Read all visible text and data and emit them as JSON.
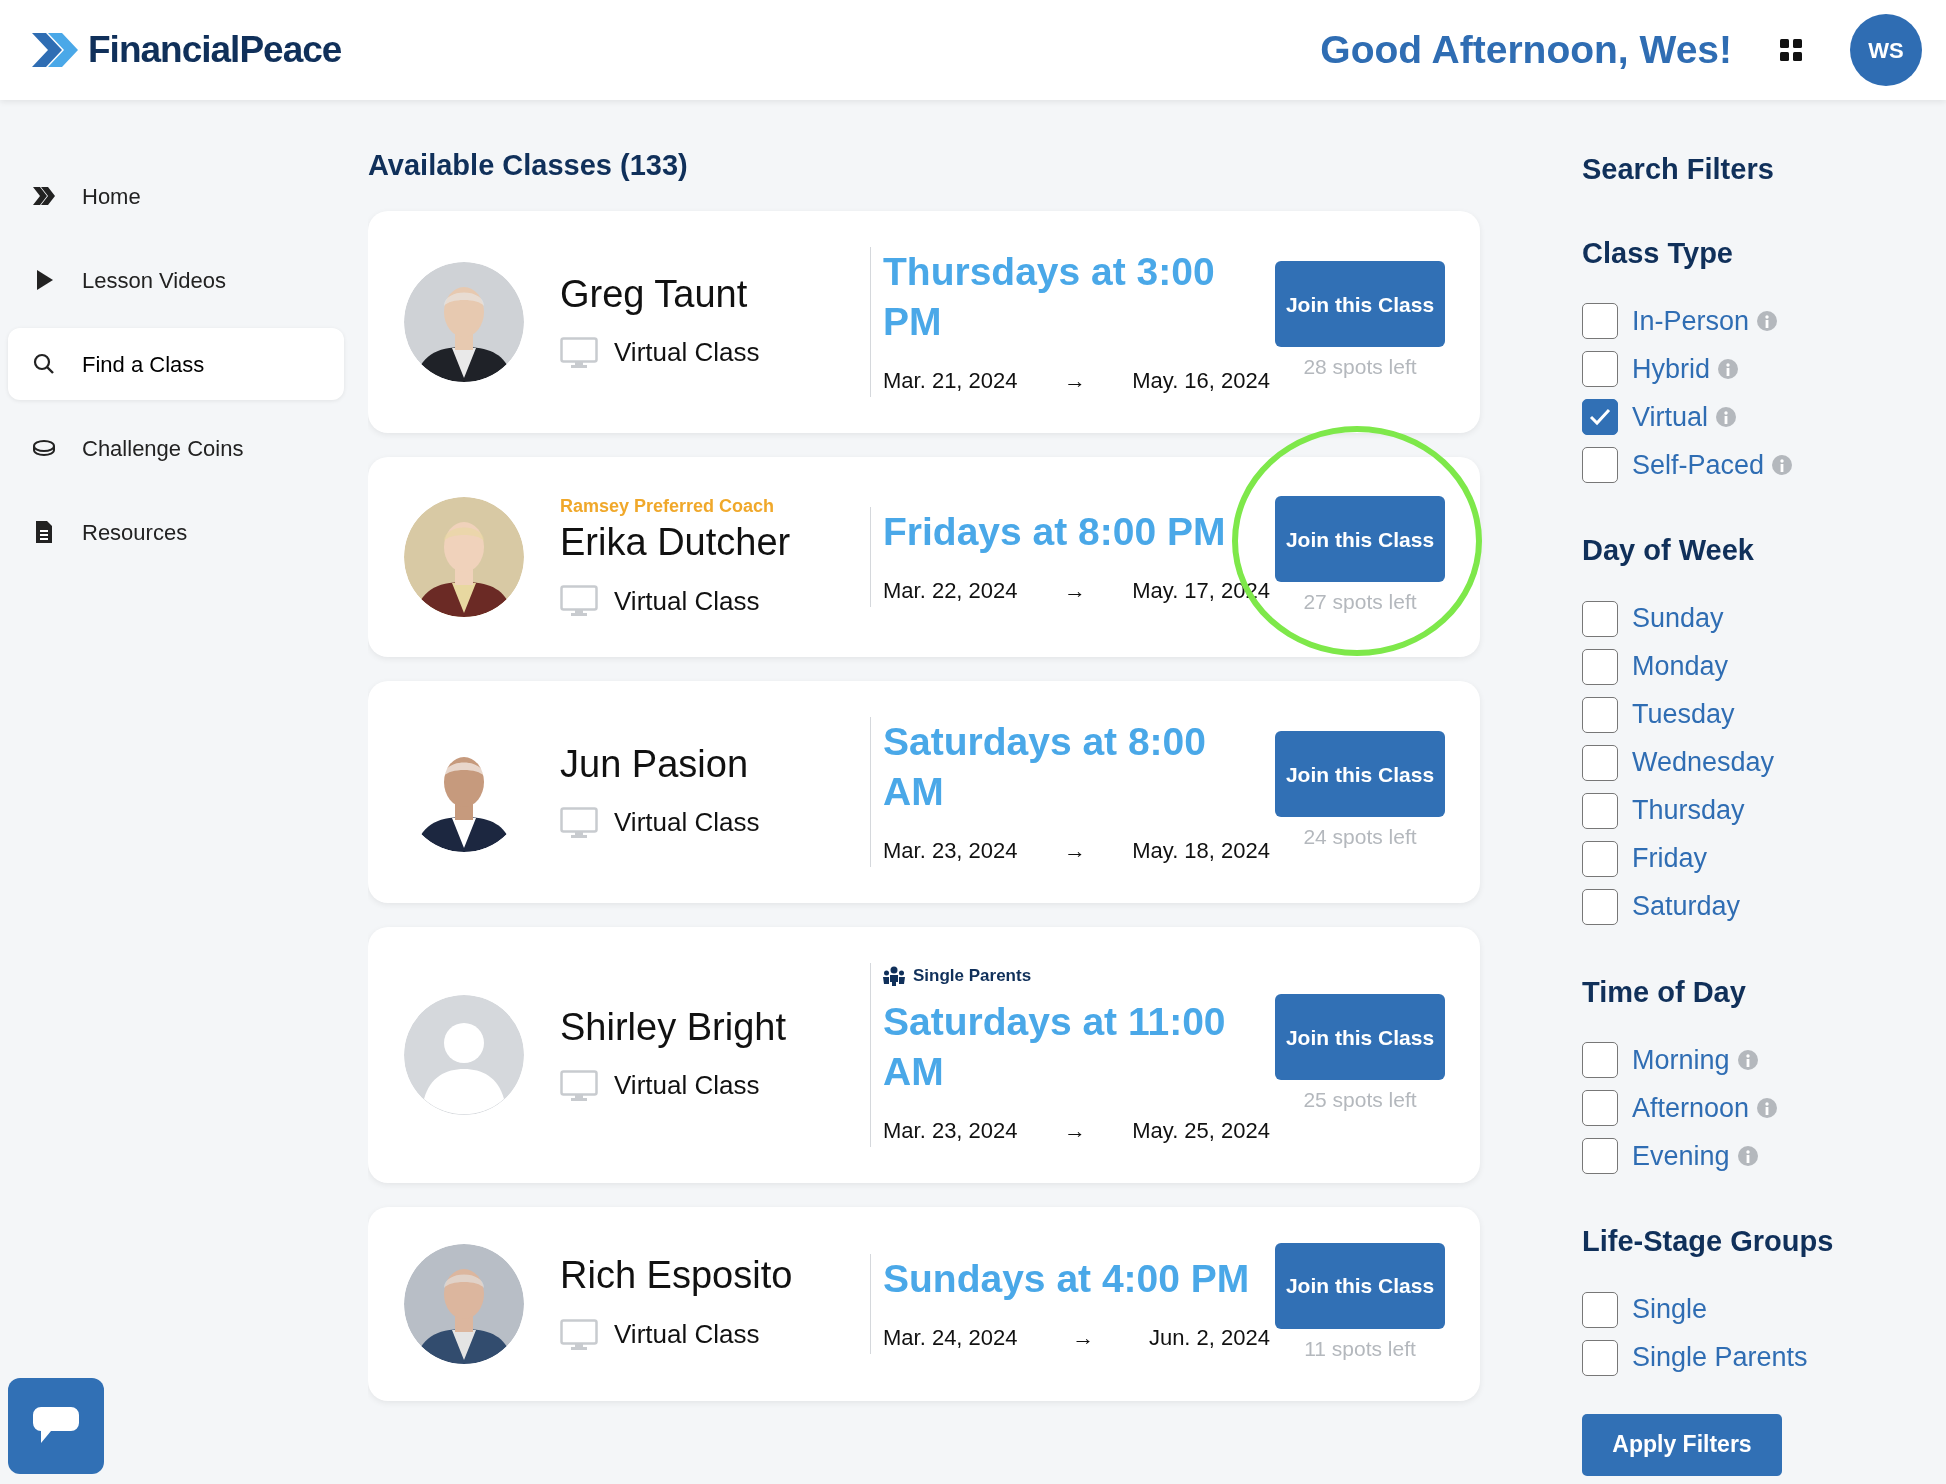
{
  "header": {
    "logo": "FinancialPeace",
    "greeting": "Good Afternoon, Wes!",
    "avatar_initials": "WS"
  },
  "sidebar": {
    "items": [
      {
        "label": "Home",
        "selected": false
      },
      {
        "label": "Lesson Videos",
        "selected": false
      },
      {
        "label": "Find a Class",
        "selected": true
      },
      {
        "label": "Challenge Coins",
        "selected": false
      },
      {
        "label": "Resources",
        "selected": false
      }
    ]
  },
  "main": {
    "title": "Available Classes (133)",
    "classes": [
      {
        "coach": "Greg Taunt",
        "format": "Virtual Class",
        "schedule": "Thursdays at 3:00 PM",
        "start": "Mar. 21, 2024",
        "arrow": "→",
        "end": "May. 16, 2024",
        "button": "Join this Class",
        "spots": "28 spots left",
        "circled": false
      },
      {
        "coach_label": "Ramsey Preferred Coach",
        "coach": "Erika Dutcher",
        "format": "Virtual Class",
        "schedule": "Fridays at 8:00 PM",
        "start": "Mar. 22, 2024",
        "arrow": "→",
        "end": "May. 17, 2024",
        "button": "Join this Class",
        "spots": "27 spots left",
        "circled": true
      },
      {
        "coach": "Jun Pasion",
        "format": "Virtual Class",
        "schedule": "Saturdays at 8:00 AM",
        "start": "Mar. 23, 2024",
        "arrow": "→",
        "end": "May. 18, 2024",
        "button": "Join this Class",
        "spots": "24 spots left",
        "circled": false
      },
      {
        "kind": "placeholder",
        "coach": "Shirley Bright",
        "format": "Virtual Class",
        "group": "Single Parents",
        "schedule": "Saturdays at 11:00 AM",
        "start": "Mar. 23, 2024",
        "arrow": "→",
        "end": "May. 25, 2024",
        "button": "Join this Class",
        "spots": "25 spots left",
        "circled": false
      },
      {
        "coach": "Rich Esposito",
        "format": "Virtual Class",
        "schedule": "Sundays at 4:00 PM",
        "start": "Mar. 24, 2024",
        "arrow": "→",
        "end": "Jun. 2, 2024",
        "button": "Join this Class",
        "spots": "11 spots left",
        "circled": false
      }
    ]
  },
  "filters": {
    "title": "Search Filters",
    "groups": [
      {
        "title": "Class Type",
        "options": [
          {
            "label": "In-Person",
            "checked": false,
            "info": true
          },
          {
            "label": "Hybrid",
            "checked": false,
            "info": true
          },
          {
            "label": "Virtual",
            "checked": true,
            "info": true
          },
          {
            "label": "Self-Paced",
            "checked": false,
            "info": true
          }
        ]
      },
      {
        "title": "Day of Week",
        "options": [
          {
            "label": "Sunday",
            "checked": false,
            "info": false
          },
          {
            "label": "Monday",
            "checked": false,
            "info": false
          },
          {
            "label": "Tuesday",
            "checked": false,
            "info": false
          },
          {
            "label": "Wednesday",
            "checked": false,
            "info": false
          },
          {
            "label": "Thursday",
            "checked": false,
            "info": false
          },
          {
            "label": "Friday",
            "checked": false,
            "info": false
          },
          {
            "label": "Saturday",
            "checked": false,
            "info": false
          }
        ]
      },
      {
        "title": "Time of Day",
        "options": [
          {
            "label": "Morning",
            "checked": false,
            "info": true
          },
          {
            "label": "Afternoon",
            "checked": false,
            "info": true
          },
          {
            "label": "Evening",
            "checked": false,
            "info": true
          }
        ]
      },
      {
        "title": "Life-Stage Groups",
        "options": [
          {
            "label": "Single",
            "checked": false,
            "info": false
          },
          {
            "label": "Single Parents",
            "checked": false,
            "info": false
          }
        ]
      }
    ],
    "apply_button": "Apply Filters"
  }
}
